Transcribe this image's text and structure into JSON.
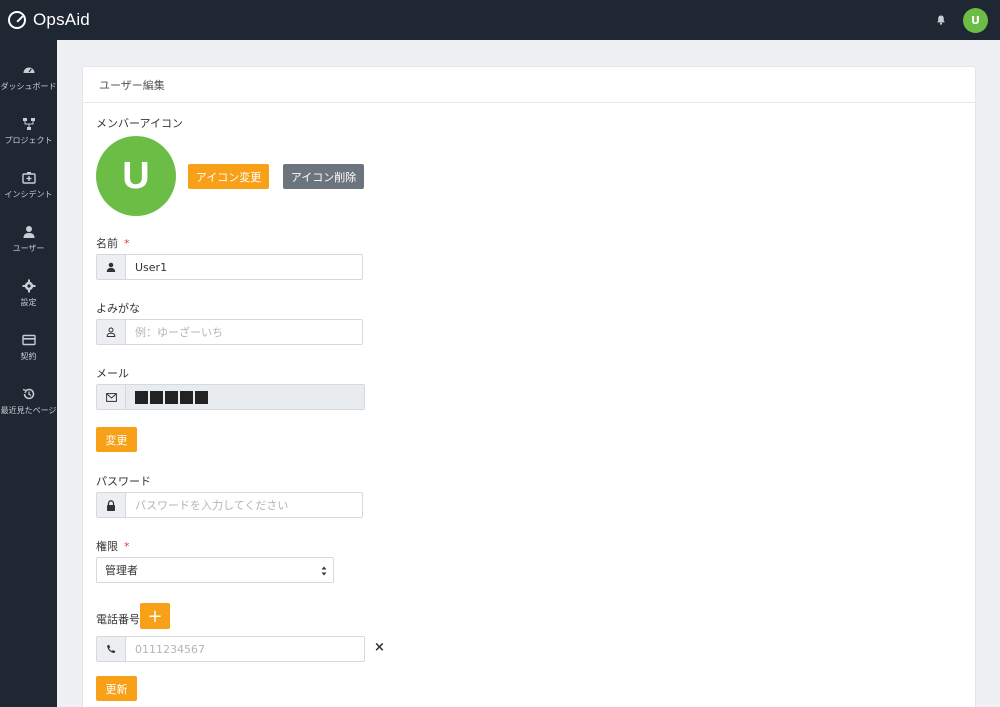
{
  "app": {
    "name": "OpsAid",
    "user_initial": "U"
  },
  "sidebar": {
    "items": [
      {
        "label": "ダッシュボード",
        "icon": "dashboard-icon"
      },
      {
        "label": "プロジェクト",
        "icon": "project-icon"
      },
      {
        "label": "インシデント",
        "icon": "incident-icon"
      },
      {
        "label": "ユーザー",
        "icon": "user-icon"
      },
      {
        "label": "設定",
        "icon": "gear-icon"
      },
      {
        "label": "契約",
        "icon": "card-icon"
      },
      {
        "label": "最近見たページ",
        "icon": "history-icon"
      }
    ]
  },
  "page": {
    "title": "ユーザー編集",
    "member_icon_label": "メンバーアイコン",
    "avatar_initial": "U",
    "change_icon_label": "アイコン変更",
    "delete_icon_label": "アイコン削除",
    "name_label": "名前",
    "name_value": "User1",
    "kana_label": "よみがな",
    "kana_placeholder": "例：ゆーざーいち",
    "email_label": "メール",
    "email_change_label": "変更",
    "password_label": "パスワード",
    "password_placeholder": "パスワードを入力してください",
    "role_label": "権限",
    "role_value": "管理者",
    "phone_label": "電話番号",
    "phone_add": "+",
    "phone_placeholder": "0111234567",
    "phone_remove": "×",
    "update_label": "更新",
    "required_mark": "*"
  },
  "colors": {
    "accent": "#f7a018",
    "avatar": "#6cbd45",
    "nav": "#1f2733",
    "gray_button": "#6c757d"
  }
}
